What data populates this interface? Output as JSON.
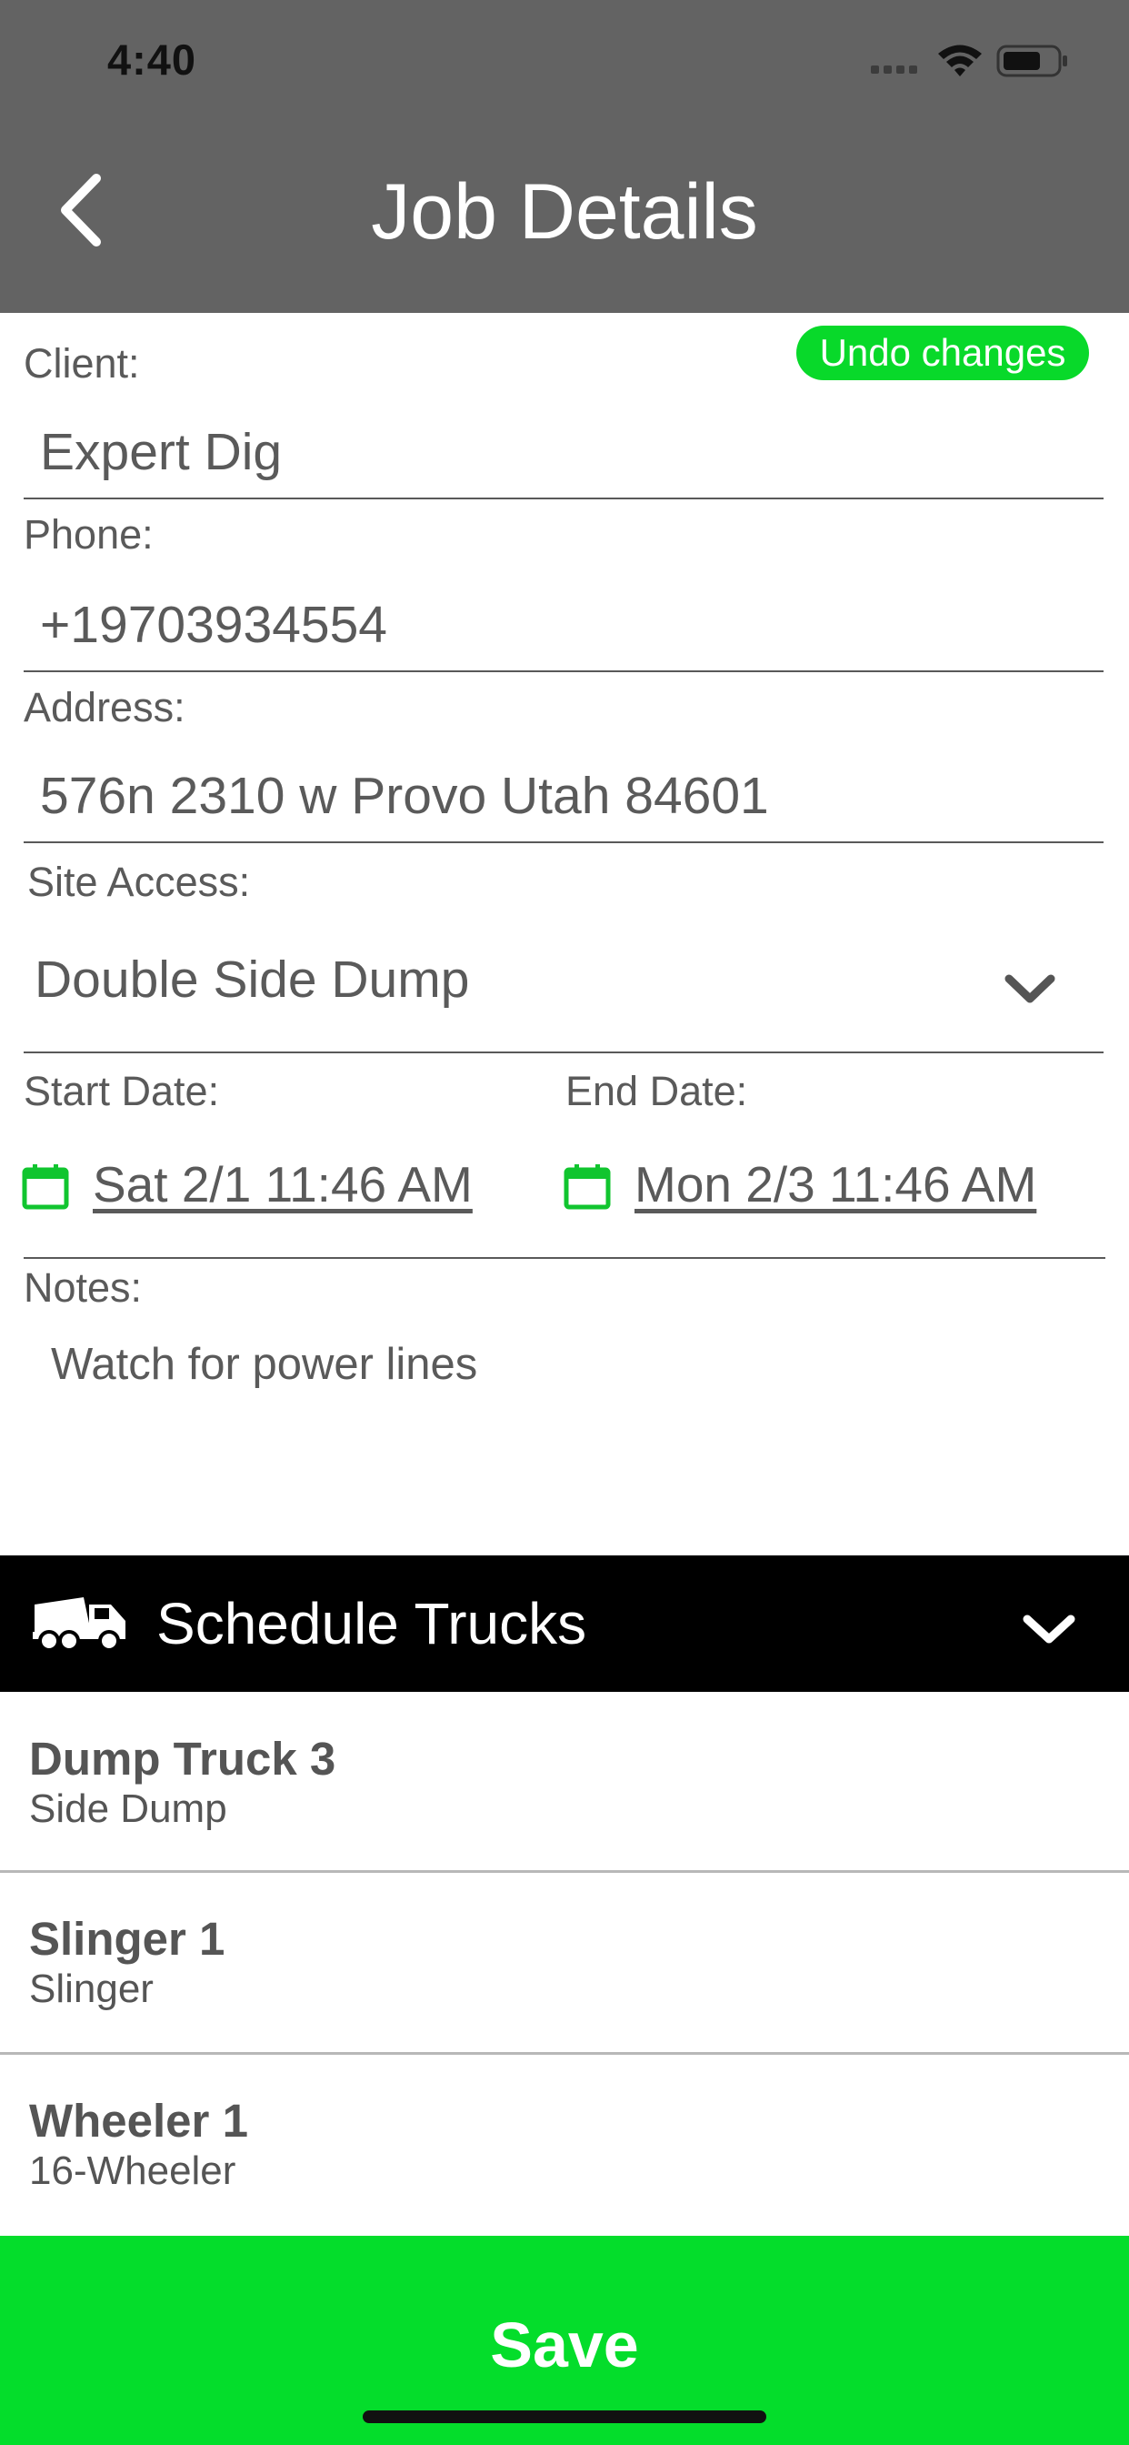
{
  "status_bar": {
    "time": "4:40"
  },
  "header": {
    "title": "Job Details"
  },
  "undo_label": "Undo changes",
  "client": {
    "label": "Client:",
    "value": "Expert Dig"
  },
  "phone": {
    "label": "Phone:",
    "value": "+19703934554"
  },
  "address": {
    "label": "Address:",
    "value": "576n 2310 w Provo Utah 84601"
  },
  "site_access": {
    "label": "Site Access:",
    "value": "Double Side Dump"
  },
  "start_date": {
    "label": "Start Date:",
    "value": "Sat 2/1 11:46 AM"
  },
  "end_date": {
    "label": "End Date:",
    "value": "Mon 2/3 11:46 AM"
  },
  "notes": {
    "label": "Notes:",
    "value": "Watch for power lines"
  },
  "schedule_trucks": {
    "title": "Schedule Trucks",
    "trucks": [
      {
        "name": "Dump Truck 3",
        "type": "Side Dump"
      },
      {
        "name": "Slinger 1",
        "type": "Slinger"
      },
      {
        "name": "Wheeler 1",
        "type": "16-Wheeler"
      }
    ]
  },
  "save_label": "Save",
  "colors": {
    "header": "#636363",
    "accent_green": "#04dd2b",
    "trucks_bar": "#000000"
  },
  "icons": [
    "back-chevron-icon",
    "calendar-icon",
    "truck-icon",
    "chevron-down-icon",
    "wifi-icon",
    "battery-icon",
    "signal-icon"
  ]
}
